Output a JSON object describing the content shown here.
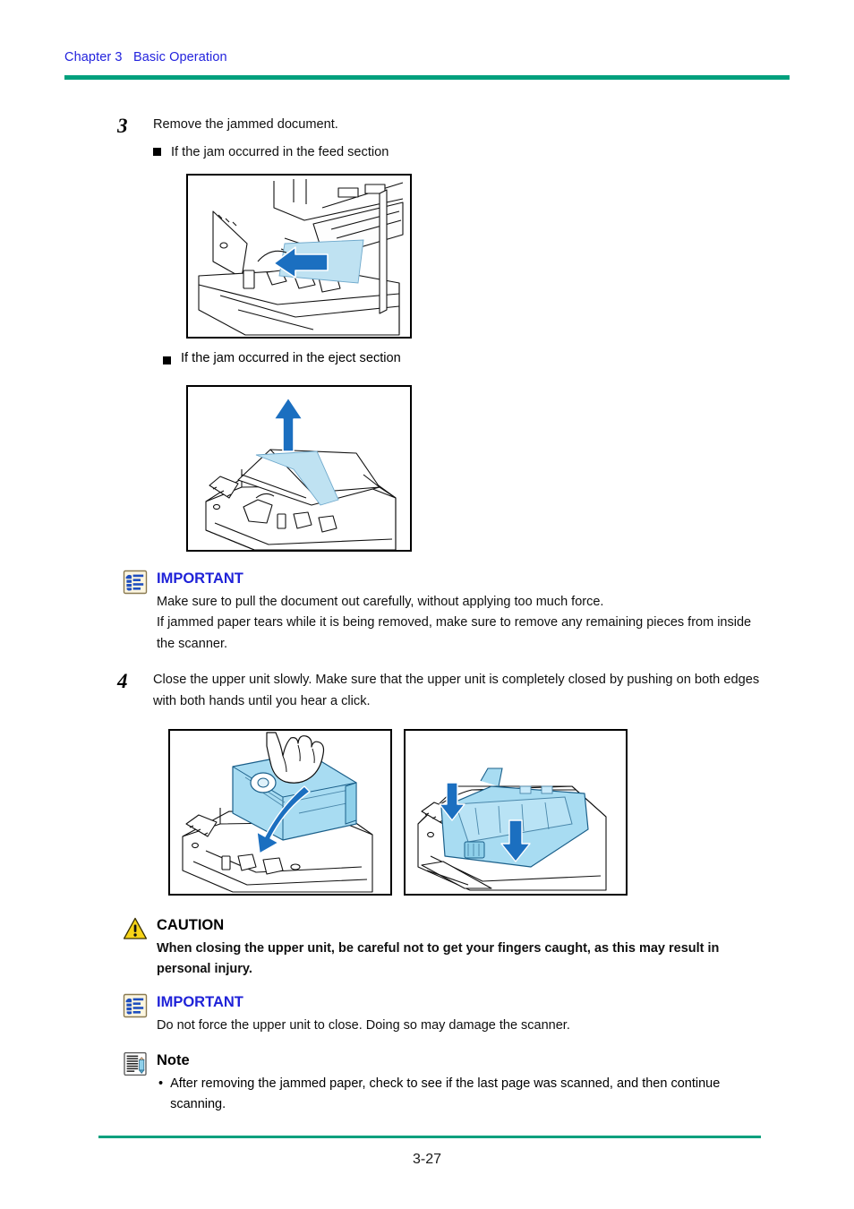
{
  "document": {
    "header": {
      "chapter": "Chapter 3",
      "section": "Basic Operation",
      "rule_color": "#00a07d",
      "text_color": "#2222dd"
    },
    "footer": {
      "page_number": "3-27",
      "rule_color": "#00a07d"
    }
  },
  "steps": [
    {
      "number": "3",
      "text": "Remove the jammed document.",
      "sub_items": [
        {
          "label": "If the jam occurred in the feed section"
        },
        {
          "label": "If the jam occurred in the eject section"
        }
      ]
    },
    {
      "number": "4",
      "text": "Close the upper unit slowly. Make sure that the upper unit is completely closed by pushing on both edges with both hands until you hear a click."
    }
  ],
  "figures": [
    {
      "name": "feed-section-jam-illustration",
      "caption": "Scanner feed section with jammed sheet being pulled out",
      "arrow_direction": "left",
      "paper_color": "#bfe2f2",
      "arrow_color": "#1b6fc0"
    },
    {
      "name": "eject-section-jam-illustration",
      "caption": "Scanner eject section with jammed sheet being pulled up",
      "arrow_direction": "up",
      "paper_color": "#bfe2f2",
      "arrow_color": "#1b6fc0"
    },
    {
      "name": "closing-upper-unit-illustration",
      "caption": "Hand closing the blue upper unit of the scanner",
      "arrow_direction": "down-curved",
      "unit_color": "#a8dcf2",
      "arrow_color": "#1b6fc0"
    },
    {
      "name": "pressing-both-edges-illustration",
      "caption": "Pressing down on both edges of the closed upper unit",
      "arrow_direction": "down",
      "unit_color": "#a8dcf2",
      "arrow_color": "#1b6fc0"
    }
  ],
  "notices": [
    {
      "id": "important-1",
      "icon": "important-icon",
      "title": "IMPORTANT",
      "title_color": "#1f22d8",
      "lines": [
        "Make sure to pull the document out carefully, without applying too much force.",
        "If jammed paper tears while it is being removed, make sure to remove any remaining pieces from inside the scanner."
      ]
    },
    {
      "id": "caution-1",
      "icon": "caution-icon",
      "title": "CAUTION",
      "title_color": "#000000",
      "lines": [
        "When closing the upper unit, be careful not to get your fingers caught, as this may result in personal injury."
      ]
    },
    {
      "id": "important-2",
      "icon": "important-icon",
      "title": "IMPORTANT",
      "title_color": "#1f22d8",
      "lines": [
        "Do not force the upper unit to close. Doing so may damage the scanner."
      ]
    },
    {
      "id": "note-1",
      "icon": "note-icon",
      "title": "Note",
      "title_color": "#000000",
      "bullets": [
        "After removing the jammed paper, check to see if the last page was scanned, and then continue scanning."
      ]
    }
  ]
}
